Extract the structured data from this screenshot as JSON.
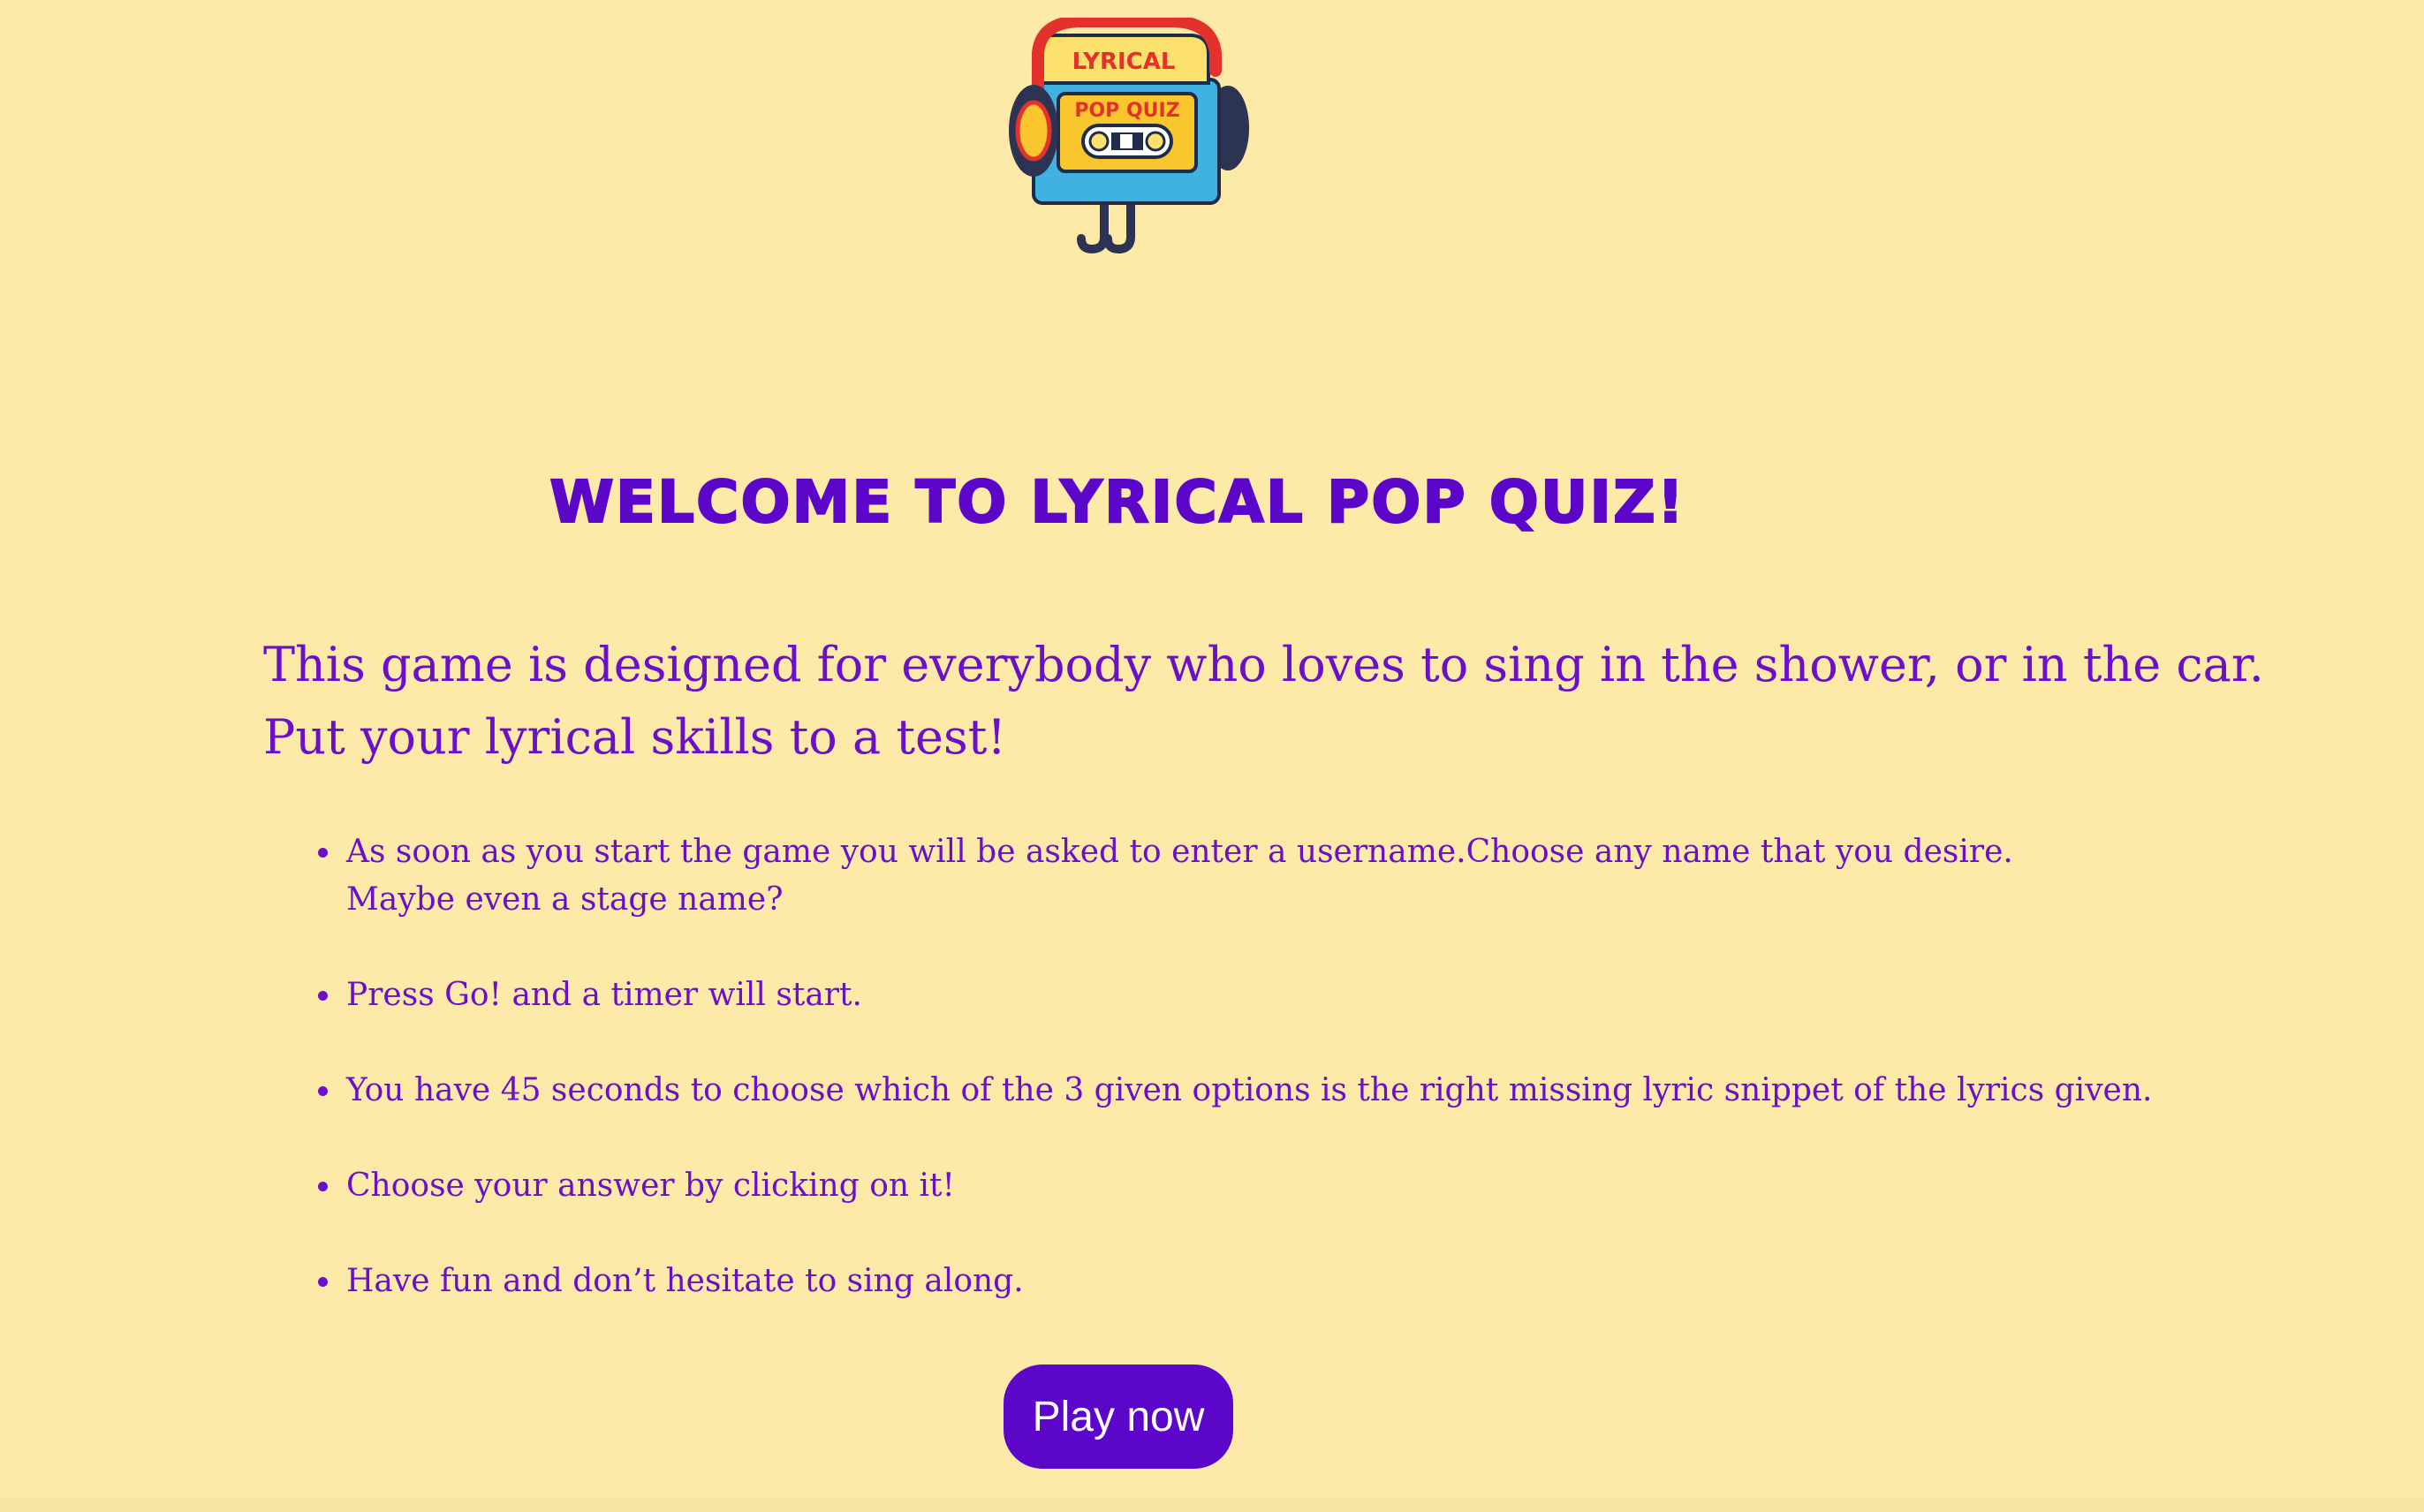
{
  "logo": {
    "text_line1": "LYRICAL",
    "text_line2": "POP QUIZ",
    "icon": "cassette-headphones-logo"
  },
  "heading": "Welcome to Lyrical Pop Quiz!",
  "intro": {
    "line1": "This game is designed for everybody who loves to sing in the shower, or in the car.",
    "line2": "Put your lyrical skills to a test!"
  },
  "rules": [
    {
      "line1": "As soon as you start the game you will be asked to enter a username.Choose any name that you desire.",
      "line2": "Maybe even a stage name?"
    },
    {
      "line1": "Press Go! and a timer will start."
    },
    {
      "line1": "You have 45 seconds to choose which of the 3 given options is the right missing lyric snippet of the lyrics given."
    },
    {
      "line1": "Choose your answer by clicking on it!"
    },
    {
      "line1": "Have fun and don’t hesitate to sing along."
    }
  ],
  "play_button": "Play now",
  "colors": {
    "background": "#fdeaa8",
    "text": "#6a10c8",
    "accent": "#5b06c9"
  }
}
